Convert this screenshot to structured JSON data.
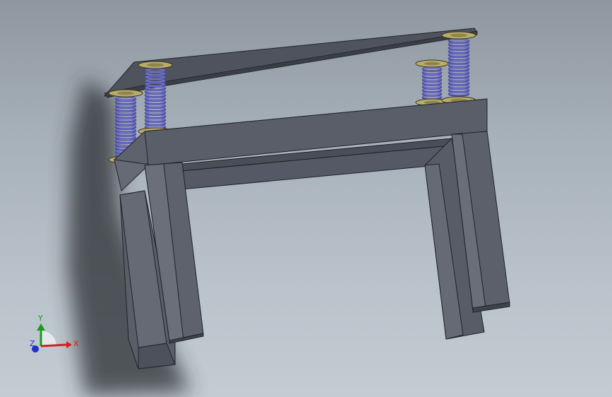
{
  "viewport": {
    "background_top": "#8e979f",
    "background_bottom": "#c3ccd3"
  },
  "model": {
    "part_color": "#5c606b",
    "part_dark": "#4a4e58",
    "part_light": "#6a6e79",
    "spring_color": "#4e4f9c",
    "washer_color": "#b8ac6a"
  },
  "triad": {
    "x_label": "X",
    "y_label": "Y",
    "z_label": "Z",
    "x_color": "#d42020",
    "y_color": "#1a9a1a",
    "z_color": "#2030c8"
  }
}
